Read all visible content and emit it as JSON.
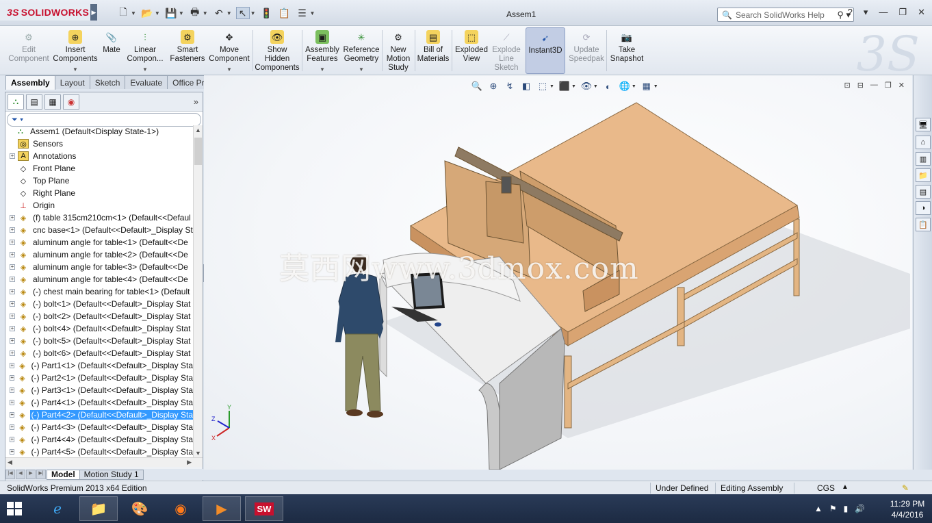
{
  "titlebar": {
    "app_logo": "SOLIDWORKS",
    "logo_prefix": "3S",
    "window_title": "Assem1",
    "search_placeholder": "Search SolidWorks Help",
    "help_label": "?"
  },
  "ribbon": {
    "buttons": [
      {
        "label": "Edit Component",
        "enabled": false
      },
      {
        "label": "Insert Components",
        "enabled": true
      },
      {
        "label": "Mate",
        "enabled": true
      },
      {
        "label": "Linear Compon...",
        "enabled": true
      },
      {
        "label": "Smart Fasteners",
        "enabled": true
      },
      {
        "label": "Move Component",
        "enabled": true
      },
      {
        "label": "Show Hidden Components",
        "enabled": true
      },
      {
        "label": "Assembly Features",
        "enabled": true
      },
      {
        "label": "Reference Geometry",
        "enabled": true
      },
      {
        "label": "New Motion Study",
        "enabled": true
      },
      {
        "label": "Bill of Materials",
        "enabled": true
      },
      {
        "label": "Exploded View",
        "enabled": true
      },
      {
        "label": "Explode Line Sketch",
        "enabled": false
      },
      {
        "label": "Instant3D",
        "enabled": true,
        "active": true
      },
      {
        "label": "Update Speedpak",
        "enabled": false
      },
      {
        "label": "Take Snapshot",
        "enabled": true
      }
    ]
  },
  "command_tabs": [
    "Assembly",
    "Layout",
    "Sketch",
    "Evaluate",
    "Office Products"
  ],
  "feature_tree": {
    "root": "Assem1  (Default<Display State-1>)",
    "items": [
      {
        "label": "Sensors",
        "icon": "sensor-icon",
        "expand": false
      },
      {
        "label": "Annotations",
        "icon": "annotation-icon",
        "expand": true
      },
      {
        "label": "Front Plane",
        "icon": "plane-icon",
        "expand": false
      },
      {
        "label": "Top Plane",
        "icon": "plane-icon",
        "expand": false
      },
      {
        "label": "Right Plane",
        "icon": "plane-icon",
        "expand": false
      },
      {
        "label": "Origin",
        "icon": "origin-icon",
        "expand": false
      },
      {
        "label": "(f) table 315cm210cm<1> (Default<<Defaul",
        "icon": "part-icon",
        "expand": true
      },
      {
        "label": "cnc base<1> (Default<<Default>_Display St",
        "icon": "part-icon",
        "expand": true
      },
      {
        "label": "aluminum angle for table<1> (Default<<De",
        "icon": "part-icon",
        "expand": true
      },
      {
        "label": "aluminum angle for table<2> (Default<<De",
        "icon": "part-icon",
        "expand": true
      },
      {
        "label": "aluminum angle for table<3> (Default<<De",
        "icon": "part-icon",
        "expand": true
      },
      {
        "label": "aluminum angle for table<4> (Default<<De",
        "icon": "part-icon",
        "expand": true
      },
      {
        "label": "(-) chest main bearing for table<1> (Default",
        "icon": "part-icon",
        "expand": true
      },
      {
        "label": "(-) bolt<1> (Default<<Default>_Display Stat",
        "icon": "part-icon",
        "expand": true
      },
      {
        "label": "(-) bolt<2> (Default<<Default>_Display Stat",
        "icon": "part-icon",
        "expand": true
      },
      {
        "label": "(-) bolt<4> (Default<<Default>_Display Stat",
        "icon": "part-icon",
        "expand": true
      },
      {
        "label": "(-) bolt<5> (Default<<Default>_Display Stat",
        "icon": "part-icon",
        "expand": true
      },
      {
        "label": "(-) bolt<6> (Default<<Default>_Display Stat",
        "icon": "part-icon",
        "expand": true
      },
      {
        "label": "(-) Part1<1> (Default<<Default>_Display Sta",
        "icon": "part-icon",
        "expand": true
      },
      {
        "label": "(-) Part2<1> (Default<<Default>_Display Sta",
        "icon": "part-icon",
        "expand": true
      },
      {
        "label": "(-) Part3<1> (Default<<Default>_Display Sta",
        "icon": "part-icon",
        "expand": true
      },
      {
        "label": "(-) Part4<1> (Default<<Default>_Display Sta",
        "icon": "part-icon",
        "expand": true
      },
      {
        "label": "(-) Part4<2> (Default<<Default>_Display Sta",
        "icon": "part-icon",
        "expand": true,
        "selected": true
      },
      {
        "label": "(-) Part4<3> (Default<<Default>_Display Sta",
        "icon": "part-icon",
        "expand": true
      },
      {
        "label": "(-) Part4<4> (Default<<Default>_Display Sta",
        "icon": "part-icon",
        "expand": true
      },
      {
        "label": "(-) Part4<5> (Default<<Default>_Display Sta",
        "icon": "part-icon",
        "expand": true
      }
    ]
  },
  "model_tabs": [
    "Model",
    "Motion Study 1"
  ],
  "viewport": {
    "watermark": "莫西网www.3dmox.com",
    "triad_labels": [
      "Y",
      "Z",
      "X"
    ]
  },
  "status": {
    "edition": "SolidWorks Premium 2013 x64 Edition",
    "definition": "Under Defined",
    "mode": "Editing Assembly",
    "units": "CGS"
  },
  "taskbar": {
    "time": "11:29 PM",
    "date": "4/4/2016",
    "apps": [
      "internet-explorer-icon",
      "file-explorer-icon",
      "paint-icon",
      "firefox-icon",
      "media-player-icon",
      "solidworks-icon"
    ],
    "solidworks_label": "SW"
  },
  "colors": {
    "selection": "#3399ff",
    "wood": "#e7b98a",
    "accent_red": "#c8102e"
  }
}
